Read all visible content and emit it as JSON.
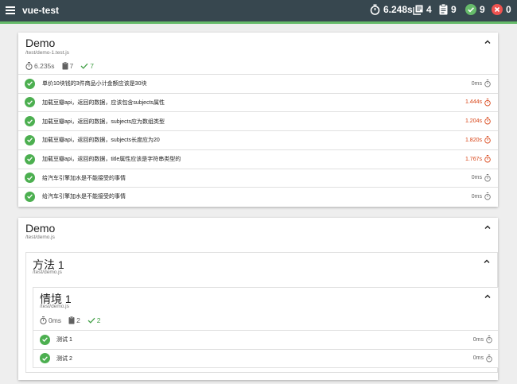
{
  "app": {
    "title": "vue-test"
  },
  "stats": {
    "duration": "6.248s",
    "suites": "4",
    "tests": "9",
    "passed": "9",
    "failed": "0"
  },
  "suite1": {
    "title": "Demo",
    "path": "/test/demo-1.test.js",
    "duration": "6.235s",
    "count": "7",
    "passed": "7",
    "tests": [
      {
        "name": "单价10块钱的3件商品小计金额应该是30块",
        "duration": "0ms",
        "slow": false
      },
      {
        "name": "加载豆瓣api，返回的数据，应该包含subjects属性",
        "duration": "1.444s",
        "slow": true
      },
      {
        "name": "加载豆瓣api，返回的数据，subjects应为数组类型",
        "duration": "1.204s",
        "slow": true
      },
      {
        "name": "加载豆瓣api，返回的数据，subjects长度应为20",
        "duration": "1.820s",
        "slow": true
      },
      {
        "name": "加载豆瓣api，返回的数据，title属性应该是字符串类型的",
        "duration": "1.767s",
        "slow": true
      },
      {
        "name": "给汽车引擎加水是不能接受的事情",
        "duration": "0ms",
        "slow": false
      },
      {
        "name": "给汽车引擎加水是不能接受的事情",
        "duration": "0ms",
        "slow": false
      }
    ]
  },
  "suite2": {
    "title": "Demo",
    "path": "/test/demo.js",
    "method": {
      "title": "方法 1",
      "path": "/test/demo.js"
    },
    "scenario": {
      "title": "情境 1",
      "path": "/test/demo.js",
      "duration": "0ms",
      "count": "2",
      "passed": "2",
      "tests": [
        {
          "name": "测试 1",
          "duration": "0ms"
        },
        {
          "name": "测试 2",
          "duration": "0ms"
        }
      ]
    }
  },
  "colors": {
    "topbar": "#37474f",
    "accent": "#66bb6a",
    "pass": "#4caf50",
    "fail": "#e53935",
    "slow": "#d84315"
  }
}
